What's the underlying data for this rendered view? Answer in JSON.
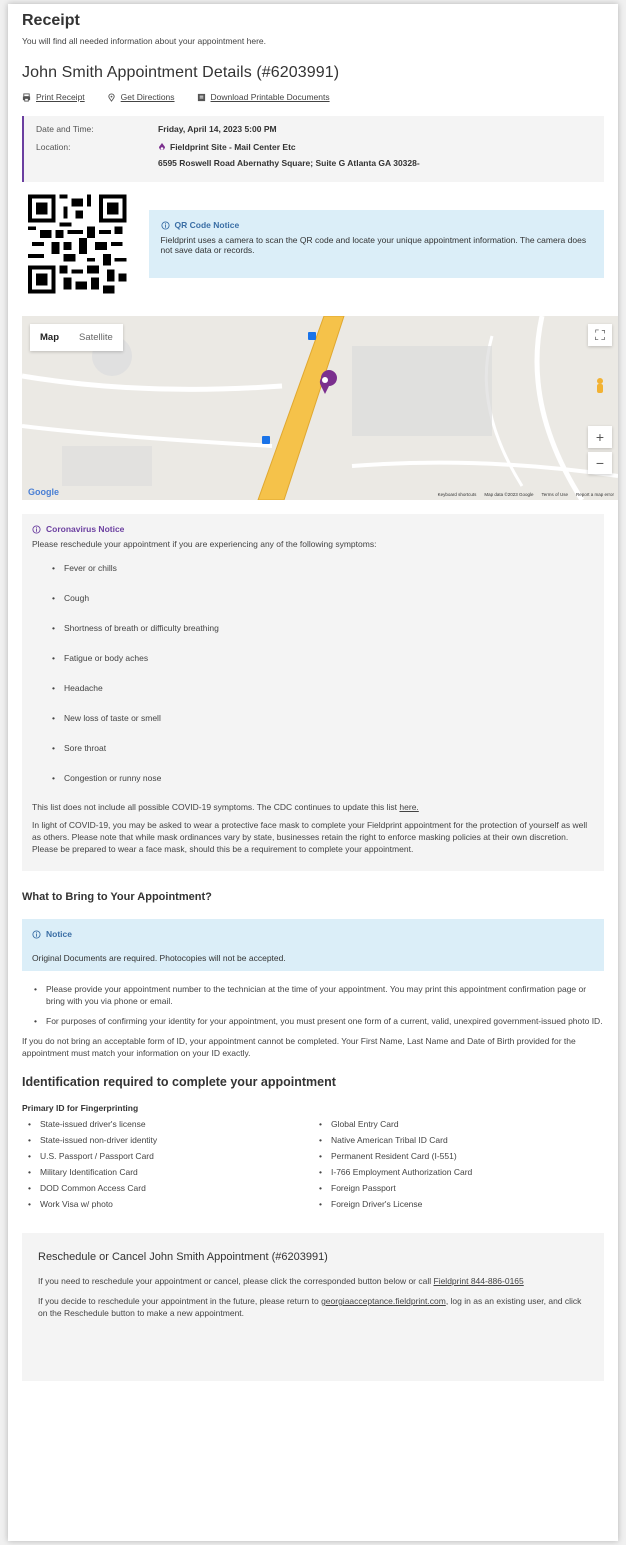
{
  "header": {
    "title": "Receipt",
    "subtitle": "You will find all needed information about your appointment here."
  },
  "appointment": {
    "title": "John Smith Appointment Details (#6203991)",
    "actions": {
      "print": "Print Receipt",
      "directions": "Get Directions",
      "download": "Download Printable Documents"
    },
    "date_label": "Date and Time:",
    "date_value": "Friday, April 14, 2023 5:00 PM",
    "location_label": "Location:",
    "location_name": "Fieldprint Site - Mail Center Etc",
    "location_address": "6595 Roswell Road Abernathy Square; Suite G Atlanta GA 30328-"
  },
  "qr_notice": {
    "title": "QR Code Notice",
    "text": "Fieldprint uses a camera to scan the QR code and locate your unique appointment information. The camera does not save data or records."
  },
  "map": {
    "tab_map": "Map",
    "tab_satellite": "Satellite",
    "fullscreen_icon": "fullscreen-icon",
    "pegman_icon": "pegman-icon",
    "zoom_in": "+",
    "zoom_out": "−",
    "logo": "Google",
    "footer": {
      "shortcuts": "Keyboard shortcuts",
      "mapdata": "Map data ©2023 Google",
      "terms": "Terms of Use",
      "report": "Report a map error"
    },
    "colors": {
      "road": "#f5c24a",
      "pin": "#7b2f8e",
      "transit": "#1a73e8"
    }
  },
  "covid": {
    "title": "Coronavirus Notice",
    "intro": "Please reschedule your appointment if you are experiencing any of the following symptoms:",
    "symptoms": [
      "Fever or chills",
      "Cough",
      "Shortness of breath or difficulty breathing",
      "Fatigue or body aches",
      "Headache",
      "New loss of taste or smell",
      "Sore throat",
      "Congestion or runny nose"
    ],
    "cdc_text": "This list does not include all possible COVID-19 symptoms. The CDC continues to update this list",
    "cdc_link": "here.",
    "mask_text": "In light of COVID-19, you may be asked to wear a protective face mask to complete your Fieldprint appointment for the protection of yourself as well as others. Please note that while mask ordinances vary by state, businesses retain the right to enforce masking policies at their own discretion. Please be prepared to wear a face mask, should this be a requirement to complete your appointment."
  },
  "bring": {
    "title": "What to Bring to Your Appointment?",
    "notice_title": "Notice",
    "notice_text": "Original Documents are required. Photocopies will not be accepted.",
    "bullets": [
      "Please provide your appointment number to the technician at the time of your appointment. You may print this appointment confirmation page or bring with you via phone or email.",
      "For purposes of confirming your identity for your appointment, you must present one form of a current, valid, unexpired government-issued photo ID."
    ],
    "warning": "If you do not bring an acceptable form of ID, your appointment cannot be completed. Your First Name, Last Name and Date of Birth provided for the appointment must match your information on your ID exactly."
  },
  "identification": {
    "title": "Identification required to complete your appointment",
    "primary_title": "Primary ID for Fingerprinting",
    "left": [
      "State-issued driver's license",
      "State-issued non-driver identity",
      "U.S. Passport / Passport Card",
      "Military Identification Card",
      "DOD Common Access Card",
      "Work Visa w/ photo"
    ],
    "right": [
      "Global Entry Card",
      "Native American Tribal ID Card",
      "Permanent Resident Card (I-551)",
      "I-766 Employment Authorization Card",
      "Foreign Passport",
      "Foreign Driver's License"
    ]
  },
  "reschedule": {
    "title": "Reschedule or Cancel John Smith Appointment (#6203991)",
    "p1": "If you need to reschedule your appointment or cancel, please click the corresponded button below or call",
    "p1_link": "Fieldprint 844-886-0165",
    "p2_a": "If you decide to reschedule your appointment in the future, please return to",
    "p2_link": "georgiaacceptance.fieldprint.com",
    "p2_b": ", log in as an existing user, and click on the Reschedule button to make a new appointment."
  }
}
